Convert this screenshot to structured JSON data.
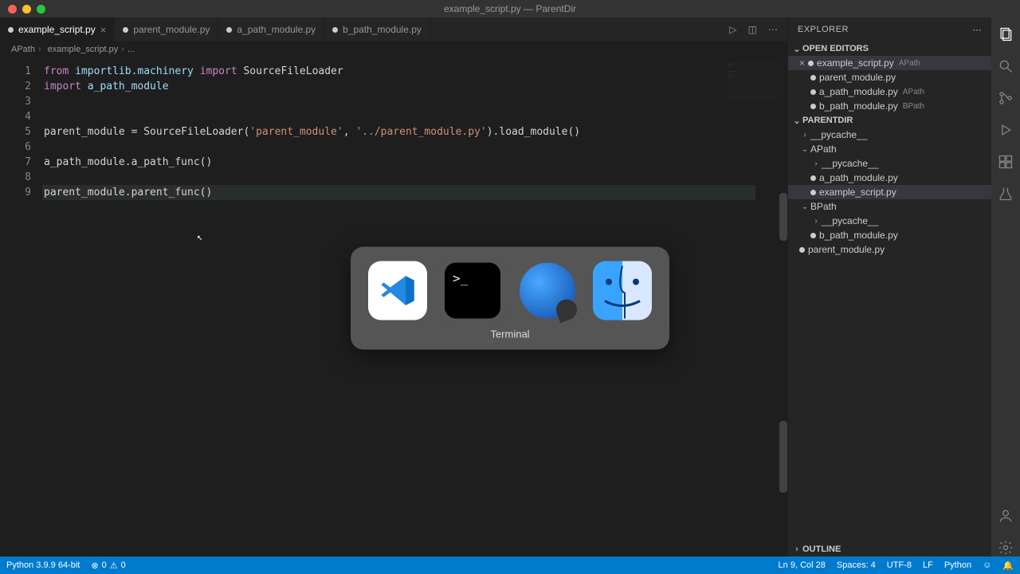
{
  "window": {
    "title": "example_script.py — ParentDir"
  },
  "tabs": [
    {
      "label": "example_script.py",
      "modified": true,
      "active": true
    },
    {
      "label": "parent_module.py",
      "modified": true
    },
    {
      "label": "a_path_module.py",
      "modified": true
    },
    {
      "label": "b_path_module.py",
      "modified": true
    }
  ],
  "breadcrumb": {
    "folder": "APath",
    "file": "example_script.py",
    "more": "..."
  },
  "code_lines": {
    "l1_from": "from",
    "l1_mod": " importlib.machinery ",
    "l1_import": "import",
    "l1_name": " SourceFileLoader",
    "l2_import": "import",
    "l2_name": " a_path_module",
    "l5_a": "parent_module = SourceFileLoader(",
    "l5_s1": "'parent_module'",
    "l5_b": ", ",
    "l5_s2": "'../parent_module.py'",
    "l5_c": ").load_module()",
    "l7": "a_path_module.a_path_func()",
    "l9": "parent_module.parent_func()"
  },
  "line_count": 9,
  "explorer": {
    "title": "EXPLORER",
    "open_editors_label": "OPEN EDITORS",
    "open_editors": [
      {
        "label": "example_script.py",
        "badge": "APath",
        "active": true
      },
      {
        "label": "parent_module.py",
        "badge": ""
      },
      {
        "label": "a_path_module.py",
        "badge": "APath"
      },
      {
        "label": "b_path_module.py",
        "badge": "BPath"
      }
    ],
    "root": "PARENTDIR",
    "tree": {
      "n0": "__pycache__",
      "n1": "APath",
      "n2": "__pycache__",
      "n3": "a_path_module.py",
      "n4": "example_script.py",
      "n5": "BPath",
      "n6": "__pycache__",
      "n7": "b_path_module.py",
      "n8": "parent_module.py"
    },
    "outline_label": "OUTLINE"
  },
  "status": {
    "python": "Python 3.9.9 64-bit",
    "errors": "0",
    "warnings": "0",
    "pos": "Ln 9, Col 28",
    "spaces": "Spaces: 4",
    "enc": "UTF-8",
    "eol": "LF",
    "lang": "Python",
    "feedback": "☺"
  },
  "dock": {
    "selected_label": "Terminal",
    "apps": [
      "vscode",
      "terminal",
      "quicktime",
      "finder"
    ]
  }
}
